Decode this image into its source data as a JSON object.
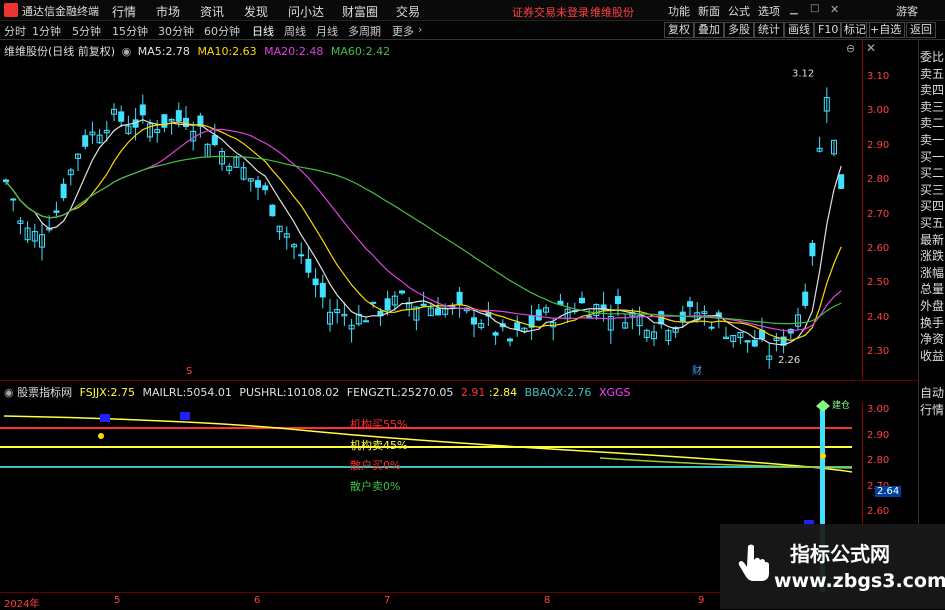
{
  "menubar": {
    "app_title": "通达信金融终端",
    "items": [
      "行情",
      "市场",
      "资讯",
      "发现",
      "问小达",
      "财富圈",
      "交易"
    ],
    "notice": "证券交易未登录",
    "stock_short": "维维股份",
    "right_items": [
      "功能",
      "新面",
      "公式",
      "选项"
    ],
    "guest": "游客"
  },
  "toolbar": {
    "periods": [
      "分时",
      "1分钟",
      "5分钟",
      "15分钟",
      "30分钟",
      "60分钟",
      "日线",
      "周线",
      "月线",
      "多周期",
      "更多"
    ],
    "active_period": "日线",
    "right_buttons": [
      "复权",
      "叠加",
      "多股",
      "统计",
      "画线",
      "F10",
      "标记",
      "+自选",
      "返回"
    ]
  },
  "main_chart": {
    "title": "维维股份(日线 前复权)",
    "ma": [
      {
        "label": "MA5:",
        "value": "2.78",
        "color": "#e0e0e0"
      },
      {
        "label": "MA10:",
        "value": "2.63",
        "color": "#ffd700"
      },
      {
        "label": "MA20:",
        "value": "2.48",
        "color": "#e040e0"
      },
      {
        "label": "MA60:",
        "value": "2.42",
        "color": "#40c040"
      }
    ],
    "price_ticks": [
      "3.10",
      "3.00",
      "2.90",
      "2.80",
      "2.70",
      "2.60",
      "2.50",
      "2.40",
      "2.30"
    ],
    "high_label": "3.12",
    "low_label": "2.26",
    "marker_s": "S",
    "marker_cai": "财"
  },
  "lower_chart": {
    "title": "股票指标网",
    "values": [
      {
        "label": "FSJJX:",
        "value": "2.75",
        "color": "#ffff40"
      },
      {
        "label": "MAILRL:",
        "value": "5054.01",
        "color": "#e0e0e0"
      },
      {
        "label": "PUSHRL:",
        "value": "10108.02",
        "color": "#e0e0e0"
      },
      {
        "label": "FENGZTL:",
        "value": "25270.05",
        "color": "#e0e0e0"
      },
      {
        "label": "",
        "value": "2.91",
        "color": "#ff3030"
      },
      {
        "label": ":",
        "value": "2.84",
        "color": "#ffff40"
      },
      {
        "label": "BBAQX:",
        "value": "2.76",
        "color": "#40c0c0"
      },
      {
        "label": "",
        "value": "XGGS",
        "color": "#ff40ff"
      }
    ],
    "line_labels": [
      {
        "text": "机构买55%",
        "color": "#ff3030"
      },
      {
        "text": "机构卖45%",
        "color": "#ffff40"
      },
      {
        "text": "散户买0%",
        "color": "#ff3030"
      },
      {
        "text": "散户卖0%",
        "color": "#40c040"
      }
    ],
    "ticks": [
      "3.00",
      "2.90",
      "2.80",
      "2.70",
      "2.60"
    ],
    "current_value": "2.64",
    "signal_label": "建仓"
  },
  "sidebar": [
    "委比",
    "卖五",
    "卖四",
    "卖三",
    "卖二",
    "卖一",
    "买一",
    "买二",
    "买三",
    "买四",
    "买五",
    "最新",
    "涨跌",
    "涨幅",
    "总量",
    "外盘",
    "换手",
    "净资",
    "收益",
    "",
    "自动",
    "行情"
  ],
  "dates": [
    "2024年",
    "5",
    "6",
    "7",
    "8",
    "9"
  ],
  "watermark": {
    "title": "指标公式网",
    "url": "www.zbgs3.com"
  },
  "chart_data": {
    "type": "candlestick",
    "ylim": [
      2.22,
      3.16
    ],
    "ma_last": {
      "MA5": 2.78,
      "MA10": 2.63,
      "MA20": 2.48,
      "MA60": 2.42
    }
  }
}
